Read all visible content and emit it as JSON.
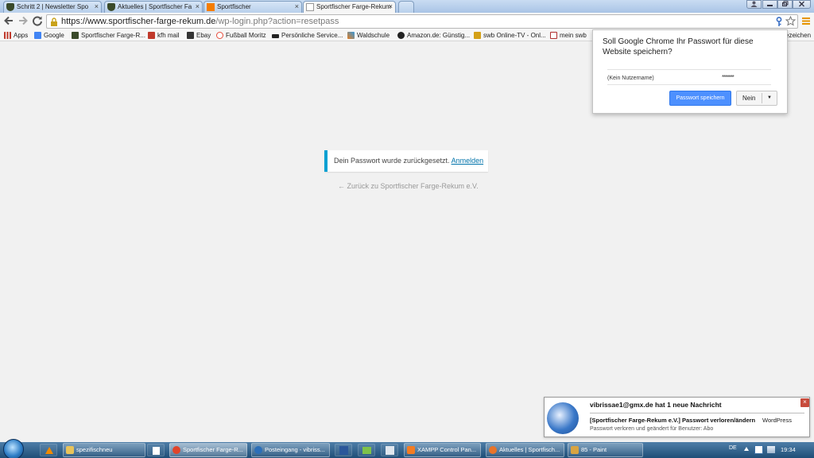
{
  "browser": {
    "tabs": [
      {
        "title": "Schritt 2 | Newsletter Spo",
        "active": false,
        "icon": "shield-favicon",
        "color": "#3a4a2a"
      },
      {
        "title": "Aktuelles | Sportfischer Fa",
        "active": false,
        "icon": "shield-favicon",
        "color": "#3a4a2a"
      },
      {
        "title": "Sportfischer",
        "active": false,
        "icon": "blogger-favicon",
        "color": "#f57d00"
      },
      {
        "title": "Sportfischer Farge-Rekum",
        "active": true,
        "icon": "page-favicon",
        "color": "#ffffff"
      }
    ],
    "tab_close": "×",
    "url_host": "https://www.sportfischer-farge-rekum.de",
    "url_path": "/wp-login.php?action=resetpass",
    "bookmarks": [
      {
        "label": "Apps",
        "icon": "apps-grid-icon",
        "color": "#c0392b"
      },
      {
        "label": "Google",
        "icon": "google-icon",
        "color": "#4285f4"
      },
      {
        "label": "Sportfischer Farge-R...",
        "icon": "shield-favicon",
        "color": "#3a4a2a"
      },
      {
        "label": "kfh mail",
        "icon": "mail-icon",
        "color": "#c0392b"
      },
      {
        "label": "Ebay",
        "icon": "bag-icon",
        "color": "#333333"
      },
      {
        "label": "Fußball Moritz",
        "icon": "ball-icon",
        "color": "#e74c3c"
      },
      {
        "label": "Persönliche Service...",
        "icon": "car-icon",
        "color": "#222222"
      },
      {
        "label": "Waldschule",
        "icon": "star-icon",
        "color": "#e67e22"
      },
      {
        "label": "Amazon.de: Günstig...",
        "icon": "amazon-icon",
        "color": "#222222"
      },
      {
        "label": "swb Online-TV - Onl...",
        "icon": "tv-icon",
        "color": "#d4a017"
      },
      {
        "label": "mein swb",
        "icon": "swb-icon",
        "color": "#b03030"
      }
    ],
    "bookmarks_overflow": "ezeichen"
  },
  "page": {
    "notice_text": "Dein Passwort wurde zurückgesetzt.",
    "notice_link": "Anmelden",
    "back_link": "← Zurück zu Sportfischer Farge-Rekum e.V."
  },
  "password_bubble": {
    "question": "Soll Google Chrome Ihr Passwort für diese Website speichern?",
    "username": "(Kein Nutzername)",
    "password_mask": "*******",
    "save_button": "Passwort speichern",
    "no_button": "Nein",
    "dropdown_arrow": "▼"
  },
  "mail_notification": {
    "header": "vibrissae1@gmx.de hat 1 neue Nachricht",
    "subject": "[Sportfischer Farge-Rekum e.V.] Passwort verloren/ändern",
    "sender": "WordPress",
    "preview": "Passwort verloren und geändert für Benutzer: Abo",
    "close": "×"
  },
  "taskbar": {
    "items": [
      {
        "label": "spezifischneu",
        "active": false,
        "icon_color": "#e8c35a"
      },
      {
        "label": "Sportfischer Farge-R...",
        "active": true,
        "icon_color": "#e0452b"
      },
      {
        "label": "Posteingang - vibriss...",
        "active": false,
        "icon_color": "#2d6fb8"
      },
      {
        "label": "XAMPP Control Pan...",
        "active": false,
        "icon_color": "#f47c22"
      },
      {
        "label": "Aktuelles | Sportfisch...",
        "active": false,
        "icon_color": "#e8742a"
      },
      {
        "label": "85 - Paint",
        "active": false,
        "icon_color": "#d9a441"
      }
    ],
    "language": "DE",
    "time": "19:34"
  }
}
